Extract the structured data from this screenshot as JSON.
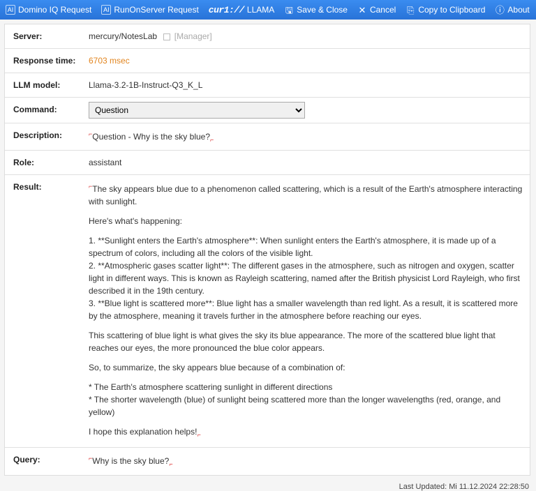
{
  "toolbar": {
    "dominoiq": "Domino IQ Request",
    "runonsrv": "RunOnServer Request",
    "curl_prefix": "cur1://",
    "llama": "LLAMA",
    "saveclose": "Save & Close",
    "cancel": "Cancel",
    "copyclip": "Copy to Clipboard",
    "about": "About"
  },
  "labels": {
    "server": "Server:",
    "responsetime": "Response time:",
    "llmmodel": "LLM model:",
    "command": "Command:",
    "description": "Description:",
    "role": "Role:",
    "result": "Result:",
    "query": "Query:"
  },
  "server": {
    "name": "mercury/NotesLab",
    "role": "[Manager]"
  },
  "response_time": "6703 msec",
  "llm_model": "Llama-3.2-1B-Instruct-Q3_K_L",
  "command_selected": "Question",
  "description": "Question - Why is the sky blue?",
  "role": "assistant",
  "result": {
    "p1": "The sky appears blue due to a phenomenon called scattering, which is a result of the Earth's atmosphere interacting with sunlight.",
    "p2": "Here's what's happening:",
    "l1": "1. **Sunlight enters the Earth's atmosphere**: When sunlight enters the Earth's atmosphere, it is made up of a spectrum of colors, including all the colors of the visible light.",
    "l2": "2. **Atmospheric gases scatter light**: The different gases in the atmosphere, such as nitrogen and oxygen, scatter light in different ways. This is known as Rayleigh scattering, named after the British physicist Lord Rayleigh, who first described it in the 19th century.",
    "l3": "3. **Blue light is scattered more**: Blue light has a smaller wavelength than red light. As a result, it is scattered more by the atmosphere, meaning it travels further in the atmosphere before reaching our eyes.",
    "p3": "This scattering of blue light is what gives the sky its blue appearance. The more of the scattered blue light that reaches our eyes, the more pronounced the blue color appears.",
    "p4": "So, to summarize, the sky appears blue because of a combination of:",
    "b1": "* The Earth's atmosphere scattering sunlight in different directions",
    "b2": "* The shorter wavelength (blue) of sunlight being scattered more than the longer wavelengths (red, orange, and yellow)",
    "p5": "I hope this explanation helps!"
  },
  "query": "Why is the sky blue?",
  "footer": "Last Updated: Mi 11.12.2024 22:28:50"
}
